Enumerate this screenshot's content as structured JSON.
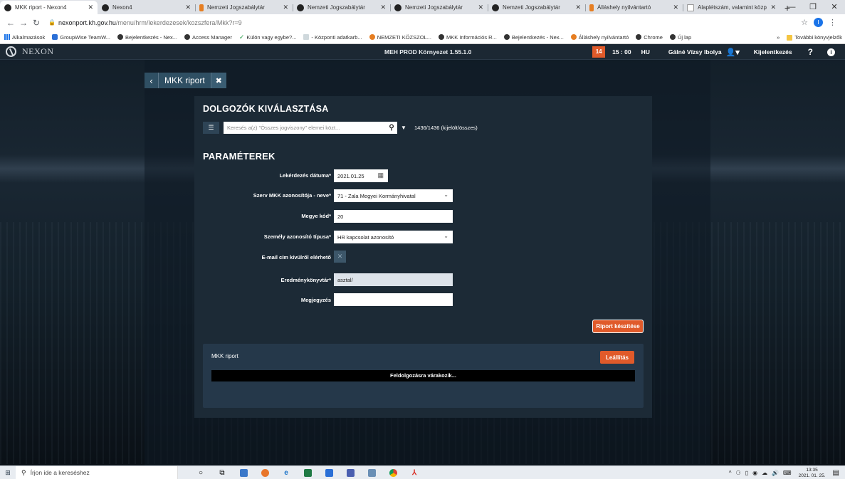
{
  "browser": {
    "tabs": [
      {
        "label": "MKK riport - Nexon4",
        "icon": "nexon-icon",
        "active": true
      },
      {
        "label": "Nexon4",
        "icon": "nexon-icon"
      },
      {
        "label": "Nemzeti Jogszabálytár",
        "icon": "jogszabaly-icon"
      },
      {
        "label": "Nemzeti Jogszabálytár",
        "icon": "globe-icon"
      },
      {
        "label": "Nemzeti Jogszabálytár",
        "icon": "globe-icon"
      },
      {
        "label": "Nemzeti Jogszabálytár",
        "icon": "globe-icon"
      },
      {
        "label": "Álláshely nyilvántartó",
        "icon": "allashely-icon"
      },
      {
        "label": "Alaplétszám, valamint közp",
        "icon": "doc-icon"
      }
    ],
    "url_host": "nexonport.kh.gov.hu",
    "url_path": "/menu/hrm/lekerdezesek/kozszfera/Mkk?r=9",
    "profile_initial": "I",
    "bookmarks": [
      {
        "label": "Alkalmazások",
        "icon": "apps-icon"
      },
      {
        "label": "GroupWise TeamW...",
        "icon": "groupwise-icon"
      },
      {
        "label": "Bejelentkezés - Nex...",
        "icon": "nexon-icon"
      },
      {
        "label": "Access Manager",
        "icon": "globe-icon"
      },
      {
        "label": "Külön vagy egybe?...",
        "icon": "check-icon"
      },
      {
        "label": "- Központi adatkarb...",
        "icon": "doc-icon"
      },
      {
        "label": "NEMZETI KÖZSZOL...",
        "icon": "orange-circle-icon"
      },
      {
        "label": "MKK Információs R...",
        "icon": "globe-icon"
      },
      {
        "label": "Bejelentkezés - Nex...",
        "icon": "nexon-icon"
      },
      {
        "label": "Álláshely nyilvántartó",
        "icon": "allashely-icon"
      },
      {
        "label": "Chrome",
        "icon": "globe-icon"
      },
      {
        "label": "Új lap",
        "icon": "globe-icon"
      }
    ],
    "bookmarks_more": "»",
    "bookmarks_other": "További könyvjelzők"
  },
  "app": {
    "logo_text": "NEXON",
    "environment": "MEH PROD Környezet 1.55.1.0",
    "notification_count": "14",
    "session_time": "15 : 00",
    "language": "HU",
    "user_name": "Gálné Vízsy Ibolya",
    "logout_label": "Kijelentkezés",
    "help_label": "?",
    "info_label": "i"
  },
  "page": {
    "title": "MKK riport",
    "employees_section_title": "DOLGOZÓK KIVÁLASZTÁSA",
    "search_placeholder": "Keresés a(z) \"Összes jogviszony\" elemei közt...",
    "selection_count": "1436/1436 (kijelölt/összes)",
    "params_section_title": "PARAMÉTEREK",
    "fields": {
      "query_date": {
        "label": "Lekérdezés dátuma*",
        "value": "2021.01.25"
      },
      "org_mkk": {
        "label": "Szerv MKK azonosítója - neve*",
        "value": "71 - Zala Megyei Kormányhivatal"
      },
      "county_code": {
        "label": "Megye kód*",
        "value": "20"
      },
      "person_id_type": {
        "label": "Személy azonosító típusa*",
        "value": "HR kapcsolat azonosító"
      },
      "email_external": {
        "label": "E-mail cím kívülről elérhető"
      },
      "result_dir": {
        "label": "Eredménykönyvtár*",
        "value": "asztal/"
      },
      "note": {
        "label": "Megjegyzés",
        "value": ""
      }
    },
    "create_report_label": "Riport készítése",
    "job": {
      "title": "MKK riport",
      "stop_label": "Leállítás",
      "status": "Feldolgozásra várakozik..."
    }
  },
  "taskbar": {
    "search_placeholder": "Írjon ide a kereséshez",
    "time": "13:35",
    "date": "2021. 01. 25."
  },
  "colors": {
    "accent": "#e05a2a",
    "panel": "#1c2a36",
    "topbar": "#1c2833"
  }
}
